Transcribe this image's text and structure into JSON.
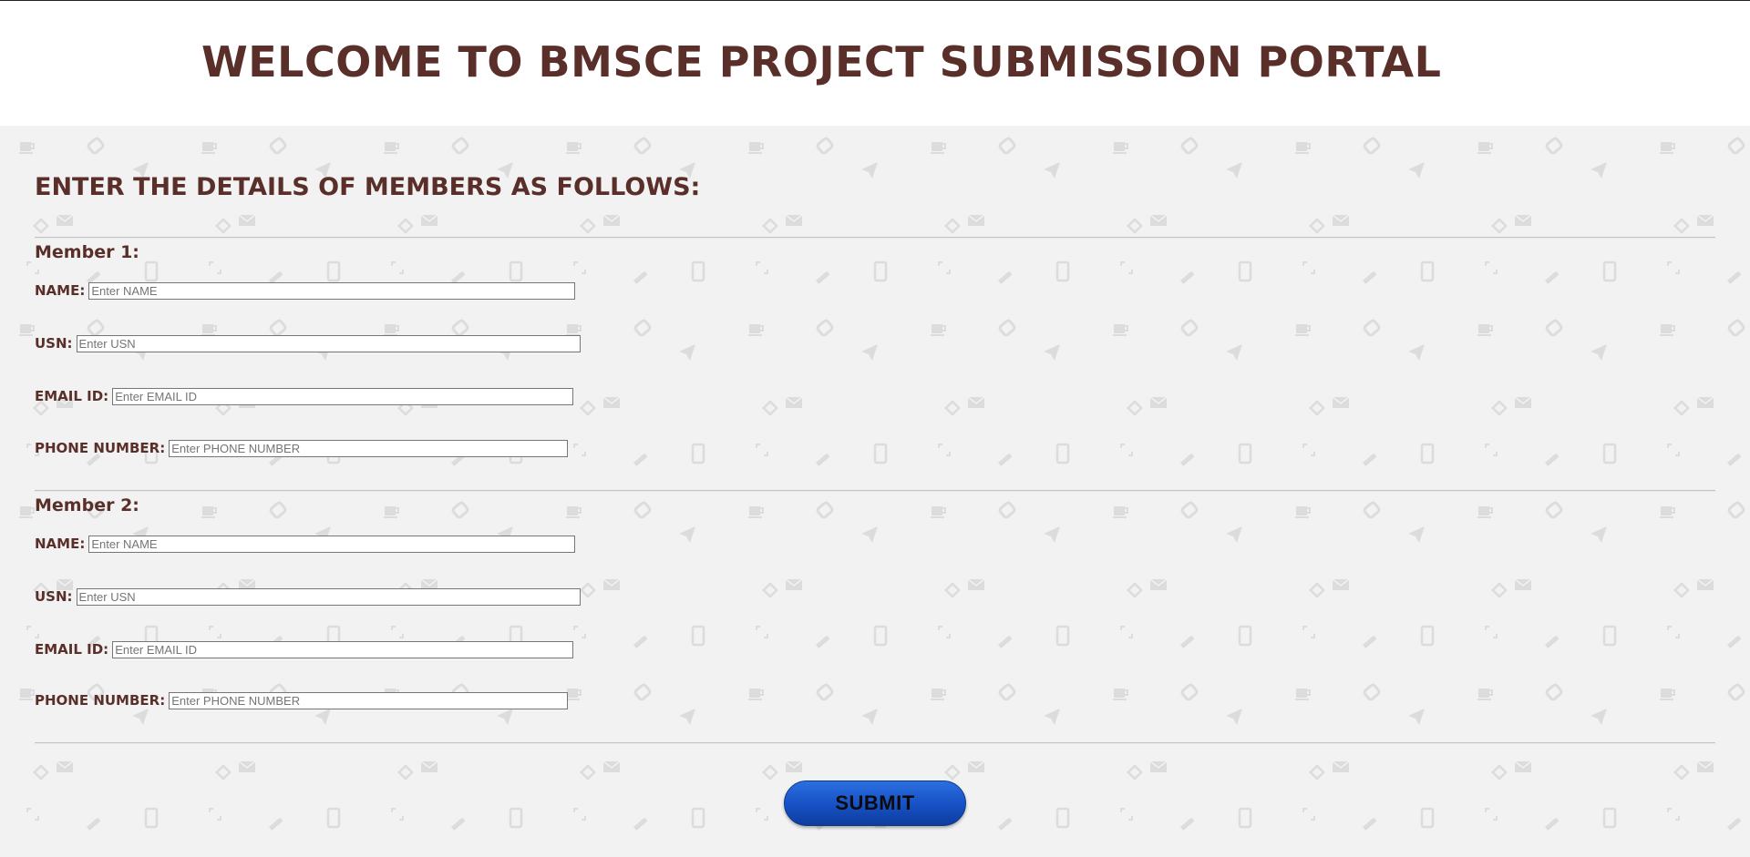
{
  "page": {
    "title": "WELCOME TO BMSCE PROJECT SUBMISSION PORTAL",
    "instructions": "ENTER THE DETAILS OF MEMBERS AS FOLLOWS:"
  },
  "members": [
    {
      "title": "Member 1:",
      "name_label": "NAME:",
      "name_placeholder": "Enter NAME",
      "usn_label": "USN:",
      "usn_placeholder": "Enter USN",
      "email_label": "EMAIL ID:",
      "email_placeholder": "Enter EMAIL ID",
      "phone_label": "PHONE NUMBER:",
      "phone_placeholder": "Enter PHONE NUMBER"
    },
    {
      "title": "Member 2:",
      "name_label": "NAME:",
      "name_placeholder": "Enter NAME",
      "usn_label": "USN:",
      "usn_placeholder": "Enter USN",
      "email_label": "EMAIL ID:",
      "email_placeholder": "Enter EMAIL ID",
      "phone_label": "PHONE NUMBER:",
      "phone_placeholder": "Enter PHONE NUMBER"
    }
  ],
  "form": {
    "submit_label": "SUBMIT"
  },
  "colors": {
    "heading": "#5a2f2a",
    "background": "#f2f2f2",
    "button": "#1650c4"
  },
  "icons": [
    "mug-icon",
    "paper-plane-icon",
    "envelope-icon",
    "phone-icon",
    "pencil-icon",
    "tag-icon"
  ]
}
